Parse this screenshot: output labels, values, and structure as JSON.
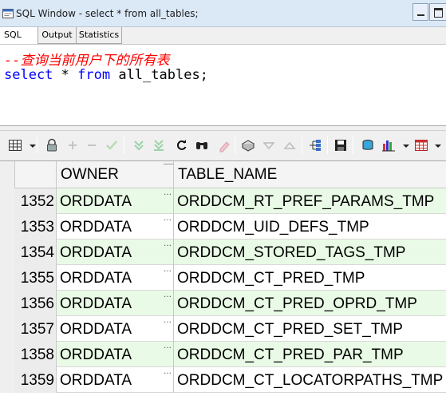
{
  "window": {
    "title": "SQL Window - select * from all_tables;"
  },
  "tabs": [
    {
      "label": "SQL"
    },
    {
      "label": "Output"
    },
    {
      "label": "Statistics"
    }
  ],
  "editor": {
    "comment": "--查询当前用户下的所有表",
    "code": {
      "kw1": "select",
      "mid": " * ",
      "kw2": "from",
      "rest": " all_tables;"
    }
  },
  "toolbar": {
    "icons": [
      "grid-icon",
      "dropdown-arrow-icon",
      "lock-icon",
      "add-row-icon",
      "delete-row-icon",
      "post-icon",
      "fetch-next-icon",
      "fetch-last-icon",
      "refresh-icon",
      "find-icon",
      "clear-icon",
      "query-by-example-icon",
      "sort-asc-icon",
      "sort-desc-icon",
      "tree-icon",
      "save-icon",
      "export-icon",
      "chart-icon",
      "table-icon"
    ]
  },
  "grid": {
    "columns": [
      "OWNER",
      "TABLE_NAME"
    ],
    "rows": [
      {
        "num": "1352",
        "owner": "ORDDATA",
        "table": "ORDDCM_RT_PREF_PARAMS_TMP"
      },
      {
        "num": "1353",
        "owner": "ORDDATA",
        "table": "ORDDCM_UID_DEFS_TMP"
      },
      {
        "num": "1354",
        "owner": "ORDDATA",
        "table": "ORDDCM_STORED_TAGS_TMP"
      },
      {
        "num": "1355",
        "owner": "ORDDATA",
        "table": "ORDDCM_CT_PRED_TMP"
      },
      {
        "num": "1356",
        "owner": "ORDDATA",
        "table": "ORDDCM_CT_PRED_OPRD_TMP"
      },
      {
        "num": "1357",
        "owner": "ORDDATA",
        "table": "ORDDCM_CT_PRED_SET_TMP"
      },
      {
        "num": "1358",
        "owner": "ORDDATA",
        "table": "ORDDCM_CT_PRED_PAR_TMP"
      },
      {
        "num": "1359",
        "owner": "ORDDATA",
        "table": "ORDDCM_CT_LOCATORPATHS_TMP"
      }
    ]
  },
  "colors": {
    "alt_row": "#e9fbe6",
    "comment": "#ff0000",
    "keyword": "#0000ff"
  }
}
